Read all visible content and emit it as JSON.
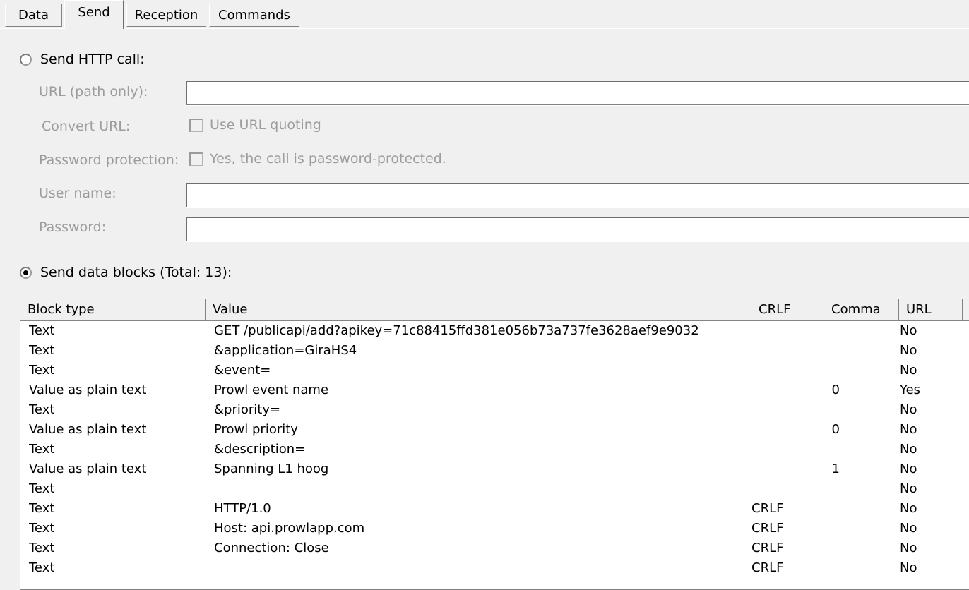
{
  "tabs": [
    {
      "label": "Data",
      "active": false
    },
    {
      "label": "Send",
      "active": true
    },
    {
      "label": "Reception",
      "active": false
    },
    {
      "label": "Commands",
      "active": false
    }
  ],
  "http_call": {
    "radio_label": "Send HTTP call:",
    "selected": false,
    "fields": {
      "url_label": "URL (path only):",
      "url_value": "",
      "convert_label": "Convert URL:",
      "convert_checkbox_label": "Use URL quoting",
      "convert_checked": false,
      "password_protection_label": "Password protection:",
      "password_protection_checkbox_label": "Yes, the call is password-protected.",
      "password_protection_checked": false,
      "user_name_label": "User name:",
      "user_name_value": "",
      "password_label": "Password:",
      "password_value": ""
    }
  },
  "data_blocks": {
    "radio_label": "Send data blocks (Total: 13):",
    "selected": true,
    "total": 13,
    "columns": [
      "Block type",
      "Value",
      "CRLF",
      "Comma",
      "URL"
    ],
    "rows": [
      {
        "block_type": "Text",
        "value": "GET /publicapi/add?apikey=71c88415ffd381e056b73a737fe3628aef9e9032",
        "crlf": "",
        "comma": "",
        "url": "No"
      },
      {
        "block_type": "Text",
        "value": "&application=GiraHS4",
        "crlf": "",
        "comma": "",
        "url": "No"
      },
      {
        "block_type": "Text",
        "value": "&event=",
        "crlf": "",
        "comma": "",
        "url": "No"
      },
      {
        "block_type": "Value as plain text",
        "value": "Prowl event name",
        "crlf": "",
        "comma": "0",
        "url": "Yes"
      },
      {
        "block_type": "Text",
        "value": "&priority=",
        "crlf": "",
        "comma": "",
        "url": "No"
      },
      {
        "block_type": "Value as plain text",
        "value": "Prowl priority",
        "crlf": "",
        "comma": "0",
        "url": "No"
      },
      {
        "block_type": "Text",
        "value": "&description=",
        "crlf": "",
        "comma": "",
        "url": "No"
      },
      {
        "block_type": "Value as plain text",
        "value": "Spanning L1 hoog",
        "crlf": "",
        "comma": "1",
        "url": "No"
      },
      {
        "block_type": "Text",
        "value": "",
        "crlf": "",
        "comma": "",
        "url": "No"
      },
      {
        "block_type": "Text",
        "value": "HTTP/1.0",
        "crlf": "CRLF",
        "comma": "",
        "url": "No"
      },
      {
        "block_type": "Text",
        "value": "Host: api.prowlapp.com",
        "crlf": "CRLF",
        "comma": "",
        "url": "No"
      },
      {
        "block_type": "Text",
        "value": "Connection: Close",
        "crlf": "CRLF",
        "comma": "",
        "url": "No"
      },
      {
        "block_type": "Text",
        "value": "",
        "crlf": "CRLF",
        "comma": "",
        "url": "No"
      }
    ]
  },
  "colors": {
    "background": "#f0f0f0",
    "field_background": "#ffffff",
    "disabled_text": "#9c9c9c",
    "text": "#000000",
    "border": "#848484"
  }
}
